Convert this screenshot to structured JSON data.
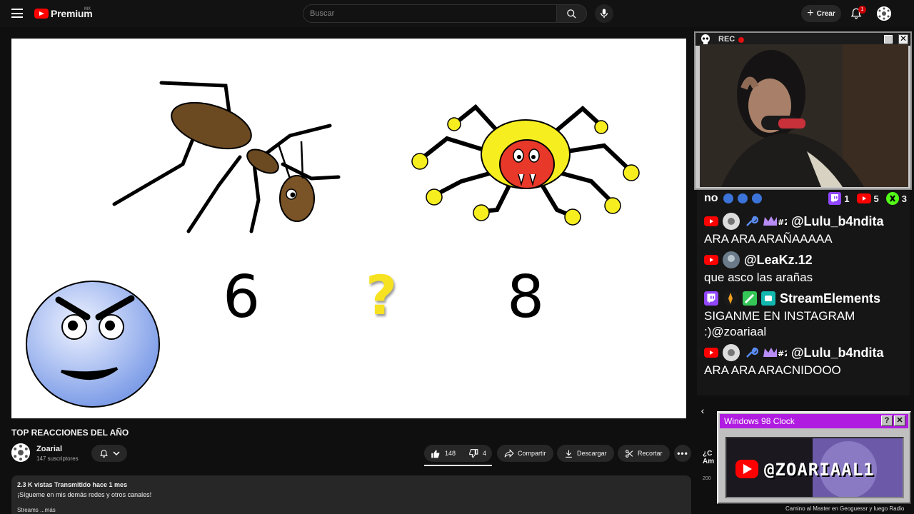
{
  "header": {
    "logo_text": "Premium",
    "logo_country": "MX",
    "search_placeholder": "Buscar",
    "create_label": "Crear",
    "notification_count": "1"
  },
  "video": {
    "left_number": "6",
    "question": "?",
    "right_number": "8"
  },
  "meta": {
    "title": "TOP REACCIONES DEL AÑO",
    "channel_name": "Zoarial",
    "subscribers": "147 suscriptores",
    "likes": "148",
    "dislikes": "4",
    "share_label": "Compartir",
    "download_label": "Descargar",
    "clip_label": "Recortar",
    "more_label": "•••",
    "views_line": "2.3 K vistas  Transmitido hace 1 mes",
    "description": "¡Sígueme en mis demás redes y otros canales!",
    "desc_links": "Streams   ...más"
  },
  "rec": {
    "label": "REC"
  },
  "chat": {
    "header_text": "no",
    "twitch_count": "1",
    "youtube_count": "5",
    "kick_count": "3",
    "messages": [
      {
        "author": "@Lulu_b4ndita",
        "text": "ARA ARA ARAÑAAAAA"
      },
      {
        "author": "@LeaKz.12",
        "text": "que asco las arañas"
      },
      {
        "author": "StreamElements",
        "text": "SIGANME EN INSTAGRAM :)@zoariaal"
      },
      {
        "author": "@Lulu_b4ndita",
        "text": "ARA ARA ARACNIDOOO"
      }
    ]
  },
  "sidebar": {
    "peek_title_1": "¿C",
    "peek_title_2": "Am",
    "peek_meta": "200",
    "bottom_text": "Camino al Master en Geoguessr y luego Radio"
  },
  "clock": {
    "title": "Windows 98 Clock",
    "help": "?",
    "close": "✕",
    "handle": "@ZOARIAAL1"
  },
  "colors": {
    "youtube_red": "#ff0000",
    "twitch_purple": "#9146ff",
    "kick_green": "#53fc18",
    "spider_yellow": "#f7ee20",
    "clock_titlebar": "#b01ce0"
  }
}
